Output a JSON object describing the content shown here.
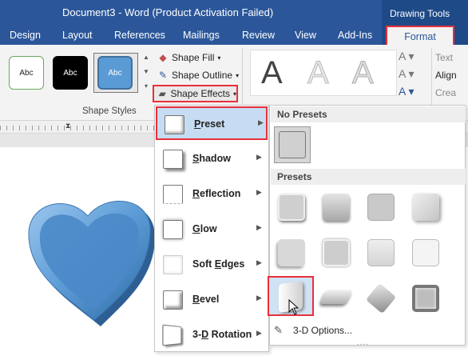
{
  "window": {
    "title": "Document3 - Word (Product Activation Failed)",
    "context_group": "Drawing Tools"
  },
  "tabs": [
    {
      "label": "Design"
    },
    {
      "label": "Layout"
    },
    {
      "label": "References"
    },
    {
      "label": "Mailings"
    },
    {
      "label": "Review"
    },
    {
      "label": "View"
    },
    {
      "label": "Add-Ins"
    },
    {
      "label": "Format",
      "active": true
    }
  ],
  "ribbon": {
    "shape_styles": {
      "swatches": [
        "Abc",
        "Abc",
        "Abc"
      ],
      "label": "Shape Styles"
    },
    "shape_fill": "Shape Fill",
    "shape_outline": "Shape Outline",
    "shape_effects": "Shape Effects",
    "wordart": [
      "A",
      "A",
      "A"
    ],
    "text_group": {
      "items": [
        "Text",
        "Align",
        "Crea"
      ]
    }
  },
  "effects_menu": [
    {
      "label": "Preset",
      "mnemonic": "P",
      "highlighted": true
    },
    {
      "label": "Shadow",
      "mnemonic": "S"
    },
    {
      "label": "Reflection",
      "mnemonic": "R"
    },
    {
      "label": "Glow",
      "mnemonic": "G"
    },
    {
      "label": "Soft Edges",
      "mnemonic": "E"
    },
    {
      "label": "Bevel",
      "mnemonic": "B"
    },
    {
      "label": "3-D Rotation",
      "mnemonic": "D"
    }
  ],
  "preset_submenu": {
    "no_presets_header": "No Presets",
    "presets_header": "Presets",
    "options": "3-D Options...",
    "selected_index": 8
  },
  "colors": {
    "titlebar": "#2b579a",
    "context": "#1e4a87",
    "highlight": "#e8303a",
    "heart": "#5b9bd5"
  }
}
